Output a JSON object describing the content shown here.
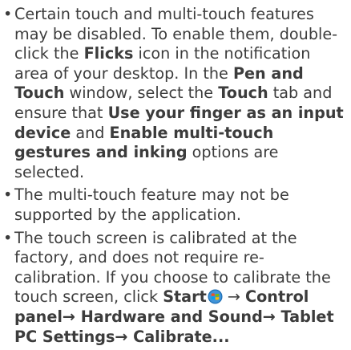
{
  "bullets": [
    {
      "t1": "Certain touch and multi-touch features may be disabled. To enable them, double-click the ",
      "b1": "Flicks",
      "t2": " icon in the notification area of your desktop. In the ",
      "b2": "Pen and Touch",
      "t3": " window, select the ",
      "b3": "Touch",
      "t4": " tab and ensure that ",
      "b4": "Use your finger as an input device",
      "t5": " and ",
      "b5": "Enable multi-touch gestures and inking",
      "t6": " options are selected."
    },
    {
      "t1": "The multi-touch feature may not be supported by the application."
    },
    {
      "t1": "The touch screen is calibrated at the factory, and does not require re-calibration. If you choose to calibrate the touch screen, click ",
      "b1": "Start",
      "icon": "windows-start-orb-icon",
      "t2": " → ",
      "b2": "Control panel→ Hardware and Sound→ Tablet PC Settings→ Calibrate..."
    }
  ]
}
